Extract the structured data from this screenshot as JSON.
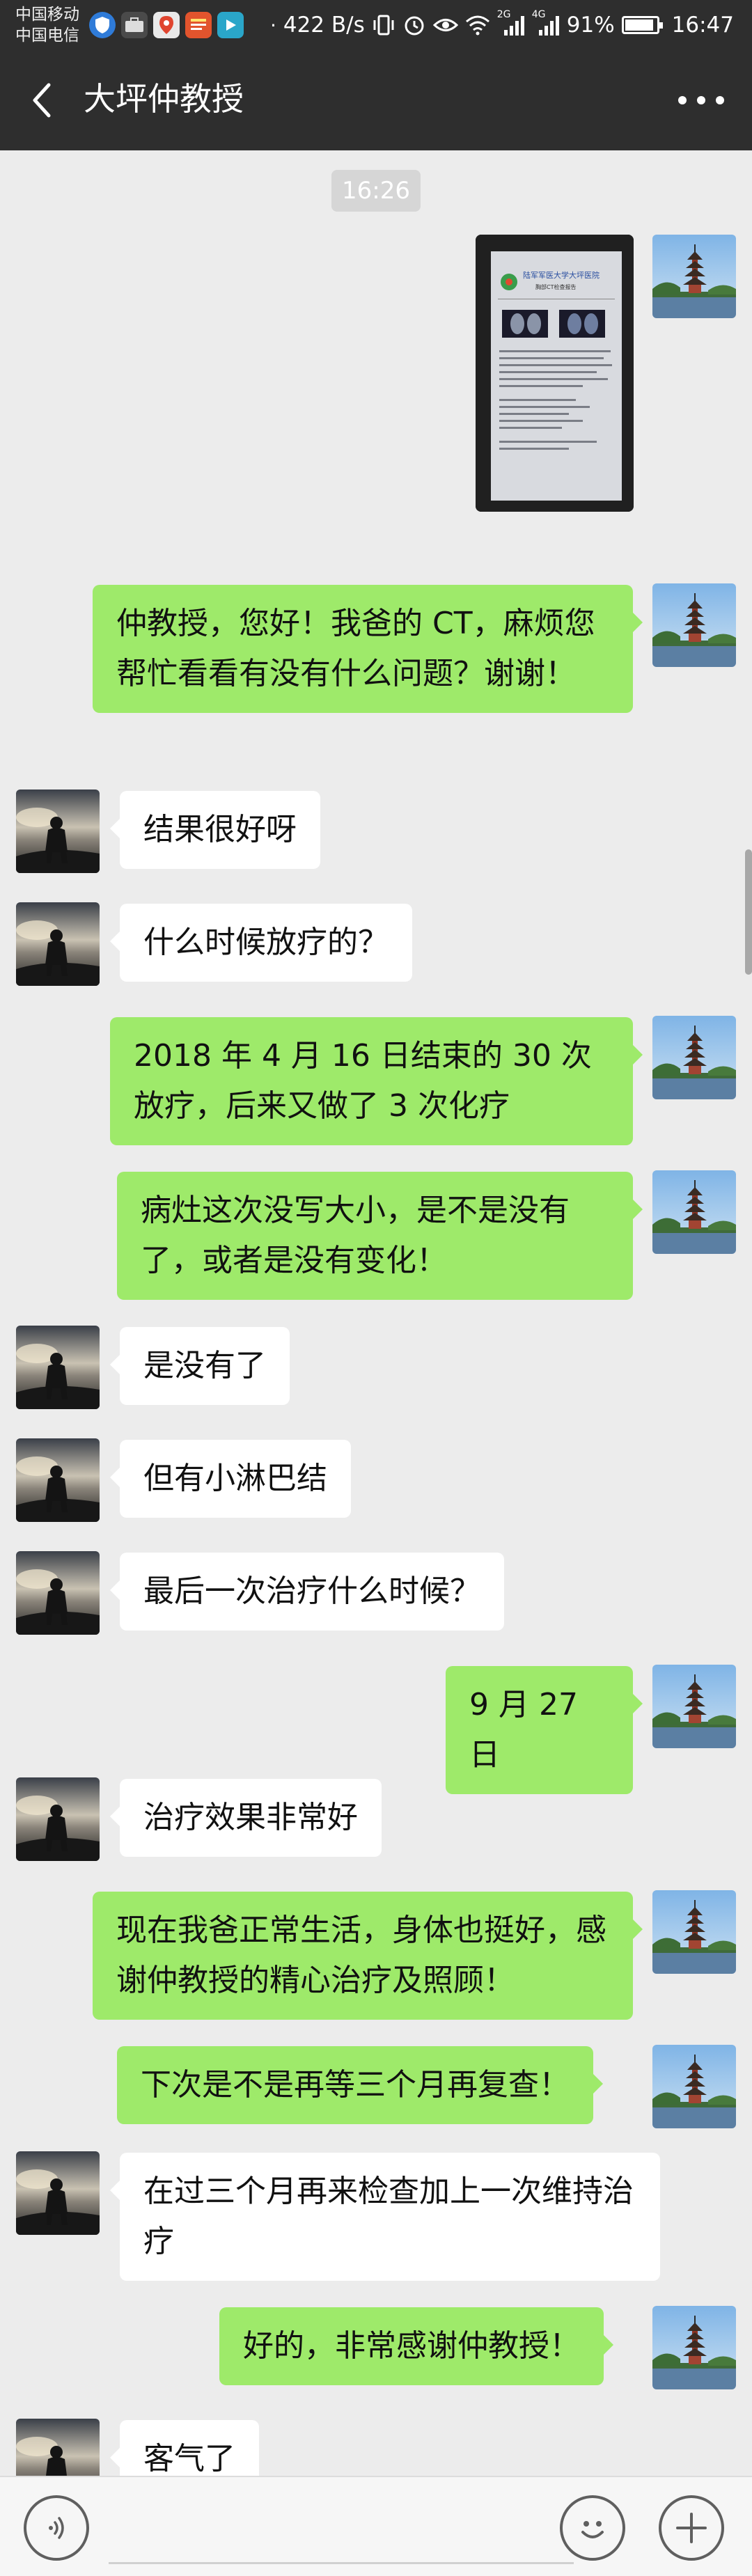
{
  "status_bar": {
    "carrier_1": "中国移动",
    "carrier_2": "中国电信",
    "net_speed": "422 B/s",
    "signal_2g": "2G",
    "signal_4g": "4G",
    "battery_text": "91%",
    "battery_level": 0.91,
    "time": "16:47",
    "app_icons": [
      "shield-icon",
      "briefcase-icon",
      "location-pin-icon",
      "news-app-icon",
      "video-app-icon"
    ]
  },
  "header": {
    "title": "大坪仲教授",
    "back_icon": "chevron-left-icon",
    "more_icon": "more-dots-icon"
  },
  "chat": {
    "timestamp": "16:26",
    "image_message": {
      "doc_title": "陆军军医大学大坪医院",
      "doc_subtitle": "胸部CT检查报告"
    },
    "messages": [
      {
        "from": "me",
        "text": "仲教授，您好！我爸的 CT，麻烦您帮忙看看有没有什么问题？谢谢！"
      },
      {
        "from": "doctor",
        "text": "结果很好呀"
      },
      {
        "from": "doctor",
        "text": "什么时候放疗的？"
      },
      {
        "from": "me",
        "text": "2018 年 4 月 16 日结束的 30 次放疗，后来又做了 3 次化疗"
      },
      {
        "from": "me",
        "text": "病灶这次没写大小，是不是没有了，或者是没有变化！"
      },
      {
        "from": "doctor",
        "text": "是没有了"
      },
      {
        "from": "doctor",
        "text": "但有小淋巴结"
      },
      {
        "from": "doctor",
        "text": "最后一次治疗什么时候？"
      },
      {
        "from": "me",
        "text": "9 月 27 日"
      },
      {
        "from": "doctor",
        "text": "治疗效果非常好"
      },
      {
        "from": "me",
        "text": "现在我爸正常生活，身体也挺好，感谢仲教授的精心治疗及照顾！"
      },
      {
        "from": "me",
        "text": "下次是不是再等三个月再复查！"
      },
      {
        "from": "doctor",
        "text": "在过三个月再来检查加上一次维持治疗"
      },
      {
        "from": "me",
        "text": "好的，非常感谢仲教授！"
      },
      {
        "from": "doctor",
        "text": "客气了"
      }
    ]
  },
  "input_bar": {
    "voice_icon": "voice-icon",
    "emoji_icon": "emoji-icon",
    "plus_icon": "plus-icon"
  },
  "colors": {
    "header_bg": "#2e2e2e",
    "chat_bg": "#ececec",
    "outgoing_bubble": "#9eea6a",
    "incoming_bubble": "#ffffff"
  }
}
